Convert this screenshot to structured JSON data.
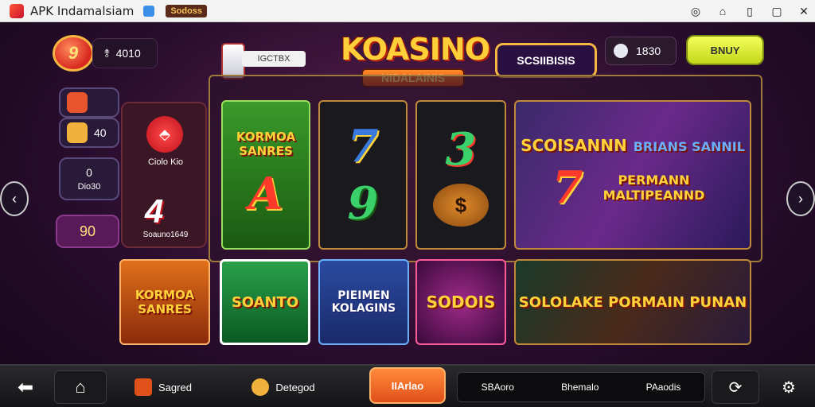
{
  "window": {
    "title": "APK Indamalsiam",
    "tag": "Sodoss",
    "controls": [
      "wifi-icon",
      "home-icon",
      "phone-icon",
      "restore-icon",
      "close-icon"
    ]
  },
  "hud": {
    "level_badge": "9",
    "balance": "4010",
    "chest_label": "IGCTBX",
    "logo_main": "KOASINO",
    "logo_sub": "NIDALAINIS",
    "jackpot": "SCSIIBISIS",
    "gems": "1830",
    "buy_label": "BNUY"
  },
  "left_panel": {
    "widget_1": "",
    "widget_2": "40",
    "widget_3_num": "0",
    "widget_3_label": "Dio30",
    "gift_label": "Ciolo Kio",
    "gift_number": "4",
    "gift_footer": "Soauno1649",
    "level_value": "90"
  },
  "games": {
    "tile_1": {
      "title": "KORMOA SANRES",
      "glyph": "A"
    },
    "tile_2": {
      "glyph_top": "7",
      "glyph_bottom": "9"
    },
    "tile_3": {
      "glyph_top": "3",
      "glyph_bottom": "$"
    },
    "tile_4": {
      "title": "SCOISANNN",
      "subtitle": "BRIANS SANNIL",
      "caption": "PERMANN MALTIPEANND",
      "glyph": "7"
    },
    "tile_5": {
      "title": "KORMOA SANRES"
    },
    "tile_6": {
      "title": "SOANTO"
    },
    "tile_7": {
      "title": "PIEIMEN KOLAGINS"
    },
    "tile_8": {
      "title": "SODOIS"
    },
    "tile_9": {
      "title": "SOLOLAKE PORMAIN PUNAN"
    }
  },
  "bottom_nav": {
    "back": "",
    "home": "",
    "item_1": "Sagred",
    "item_2": "Detegod",
    "active": "IIArlao",
    "group": [
      "SBAoro",
      "Bhemalo",
      "PAaodis"
    ],
    "refresh": "",
    "settings": ""
  },
  "colors": {
    "accent_gold": "#f5b642",
    "active_orange": "#ff8a3a",
    "buy_lime": "#e6f53a"
  }
}
